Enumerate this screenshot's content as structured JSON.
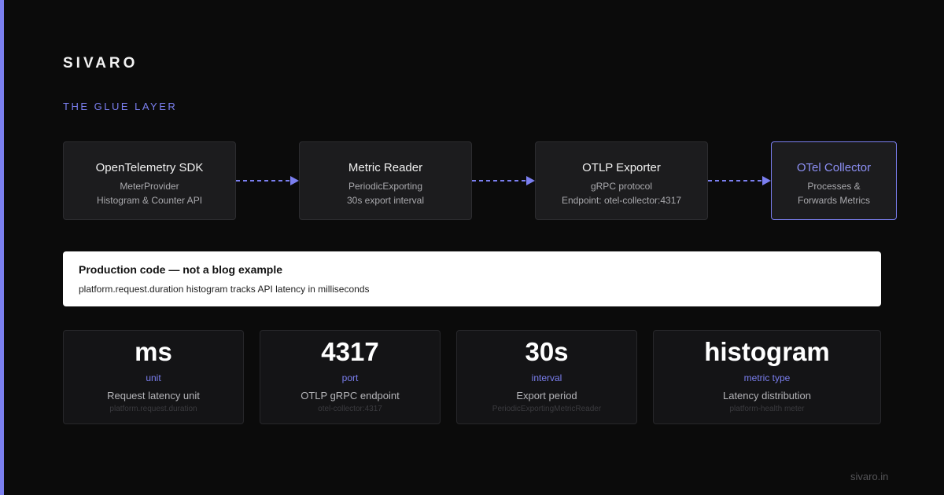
{
  "brand": "SIVARO",
  "section_label": "THE GLUE LAYER",
  "pipeline": [
    {
      "title": "OpenTelemetry SDK",
      "lines": [
        "MeterProvider",
        "Histogram & Counter API"
      ]
    },
    {
      "title": "Metric Reader",
      "lines": [
        "PeriodicExporting",
        "30s export interval"
      ]
    },
    {
      "title": "OTLP Exporter",
      "lines": [
        "gRPC protocol",
        "Endpoint: otel-collector:4317"
      ]
    },
    {
      "title": "OTel Collector",
      "lines": [
        "Processes &",
        "Forwards Metrics"
      ]
    }
  ],
  "callout": {
    "heading": "Production code — not a blog example",
    "text": "platform.request.duration histogram tracks API latency in milliseconds"
  },
  "stats": [
    {
      "value": "ms",
      "key": "unit",
      "desc": "Request latency unit",
      "ref": "platform.request.duration"
    },
    {
      "value": "4317",
      "key": "port",
      "desc": "OTLP gRPC endpoint",
      "ref": "otel-collector:4317"
    },
    {
      "value": "30s",
      "key": "interval",
      "desc": "Export period",
      "ref": "PeriodicExportingMetricReader"
    },
    {
      "value": "histogram",
      "key": "metric type",
      "desc": "Latency distribution",
      "ref": "platform-health meter"
    }
  ],
  "footer": "sivaro.in",
  "colors": {
    "accent": "#7b7ff0",
    "background": "#0b0b0b",
    "box": "#1c1c1e"
  }
}
